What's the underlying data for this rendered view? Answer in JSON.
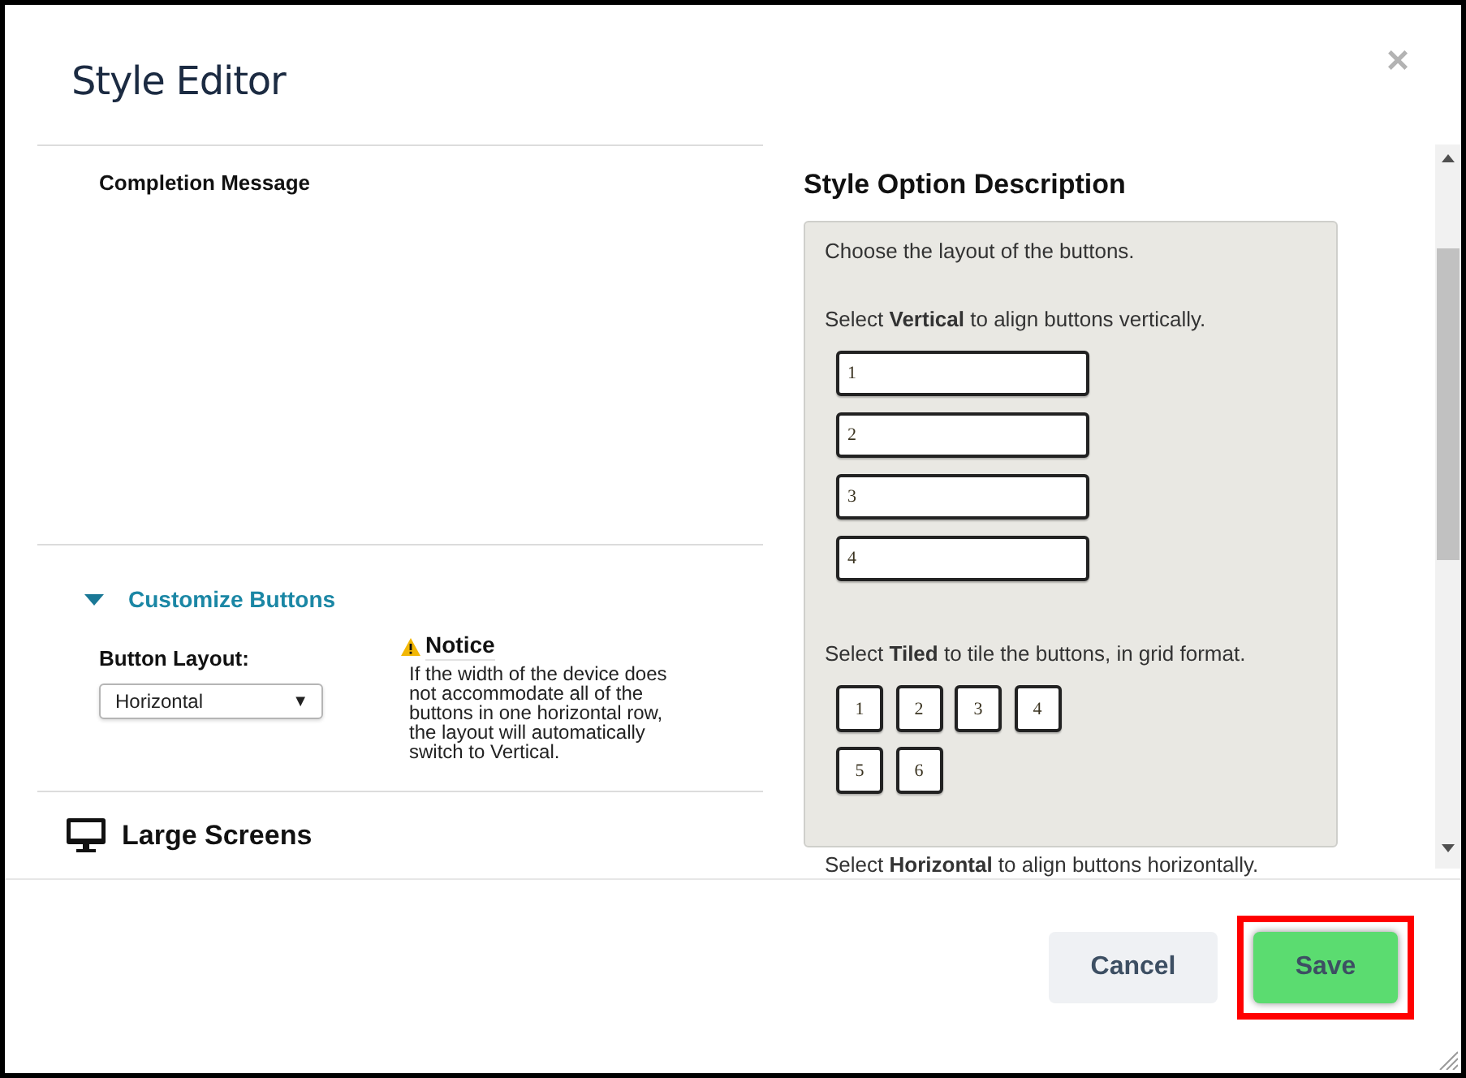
{
  "window": {
    "title": "Style Editor",
    "close": "×"
  },
  "left_panel": {
    "section_title": "Completion Message",
    "customize": {
      "label": "Customize Buttons",
      "expanded": true,
      "field_label": "Button Layout:",
      "select": {
        "value": "Horizontal",
        "arrow": "▼"
      },
      "notice": {
        "title": "Notice",
        "text": "If the width of the device does not accommodate all of the buttons in one horizontal row, the layout will automatically switch to Vertical."
      }
    },
    "large_screens": {
      "label": "Large Screens"
    }
  },
  "description": {
    "title": "Style Option Description",
    "intro": "Choose the layout of the buttons.",
    "vertical": {
      "text": "Select **Vertical** to align buttons vertically.",
      "buttons": [
        "1",
        "2",
        "3",
        "4"
      ]
    },
    "tiled": {
      "text": "Select **Tiled** to tile the buttons, in grid format.",
      "buttons": [
        "1",
        "2",
        "3",
        "4",
        "5",
        "6"
      ]
    },
    "horizontal": {
      "text": "Select **Horizontal** to align buttons horizontally."
    }
  },
  "footer": {
    "buttons": [
      {
        "label": "Cancel",
        "kind": "secondary",
        "highlighted": false
      },
      {
        "label": "Save",
        "kind": "primary",
        "highlighted": true
      }
    ]
  }
}
